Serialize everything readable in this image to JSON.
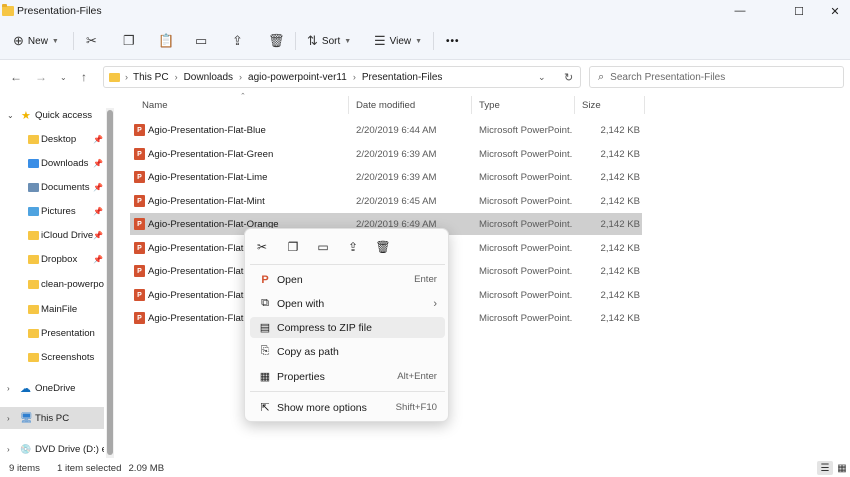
{
  "window": {
    "title": "Presentation-Files",
    "controls": [
      "—",
      "☐",
      "✕"
    ]
  },
  "toolbar": {
    "new_label": "New",
    "sort_label": "Sort",
    "view_label": "View",
    "more_label": "•••"
  },
  "address": {
    "crumbs": [
      "This PC",
      "Downloads",
      "agio-powerpoint-ver11",
      "Presentation-Files"
    ],
    "search_placeholder": "Search Presentation-Files"
  },
  "sidebar": {
    "quick_access": "Quick access",
    "pinned": [
      "Desktop",
      "Downloads",
      "Documents",
      "Pictures",
      "iCloud Drive",
      "Dropbox"
    ],
    "folders": [
      "clean-powerpoi",
      "MainFile",
      "Presentation",
      "Screenshots"
    ],
    "onedrive": "OneDrive",
    "this_pc": "This PC",
    "dvd": "DVD Drive (D:) es"
  },
  "columns": {
    "name": "Name",
    "date": "Date modified",
    "type": "Type",
    "size": "Size"
  },
  "files": [
    {
      "name": "Agio-Presentation-Flat-Blue",
      "date": "2/20/2019 6:44 AM",
      "type": "Microsoft PowerPoint...",
      "size": "2,142 KB"
    },
    {
      "name": "Agio-Presentation-Flat-Green",
      "date": "2/20/2019 6:39 AM",
      "type": "Microsoft PowerPoint...",
      "size": "2,142 KB"
    },
    {
      "name": "Agio-Presentation-Flat-Lime",
      "date": "2/20/2019 6:39 AM",
      "type": "Microsoft PowerPoint...",
      "size": "2,142 KB"
    },
    {
      "name": "Agio-Presentation-Flat-Mint",
      "date": "2/20/2019 6:45 AM",
      "type": "Microsoft PowerPoint...",
      "size": "2,142 KB"
    },
    {
      "name": "Agio-Presentation-Flat-Orange",
      "date": "2/20/2019 6:49 AM",
      "type": "Microsoft PowerPoint...",
      "size": "2,142 KB"
    },
    {
      "name": "Agio-Presentation-Flat-",
      "date": "",
      "type": "Microsoft PowerPoint...",
      "size": "2,142 KB"
    },
    {
      "name": "Agio-Presentation-Flat-",
      "date": "",
      "type": "Microsoft PowerPoint...",
      "size": "2,142 KB"
    },
    {
      "name": "Agio-Presentation-Flat-",
      "date": "",
      "type": "Microsoft PowerPoint...",
      "size": "2,142 KB"
    },
    {
      "name": "Agio-Presentation-Flat-",
      "date": "",
      "type": "Microsoft PowerPoint...",
      "size": "2,142 KB"
    }
  ],
  "context_menu": {
    "open": {
      "label": "Open",
      "key": "Enter"
    },
    "open_with": {
      "label": "Open with"
    },
    "compress": {
      "label": "Compress to ZIP file"
    },
    "copy_path": {
      "label": "Copy as path"
    },
    "properties": {
      "label": "Properties",
      "key": "Alt+Enter"
    },
    "more_options": {
      "label": "Show more options",
      "key": "Shift+F10"
    }
  },
  "status": {
    "count": "9 items",
    "selection": "1 item selected",
    "size": "2.09 MB"
  },
  "colors": {
    "accent": "#0067c0",
    "ppt": "#d35230",
    "folder": "#f6c645"
  }
}
